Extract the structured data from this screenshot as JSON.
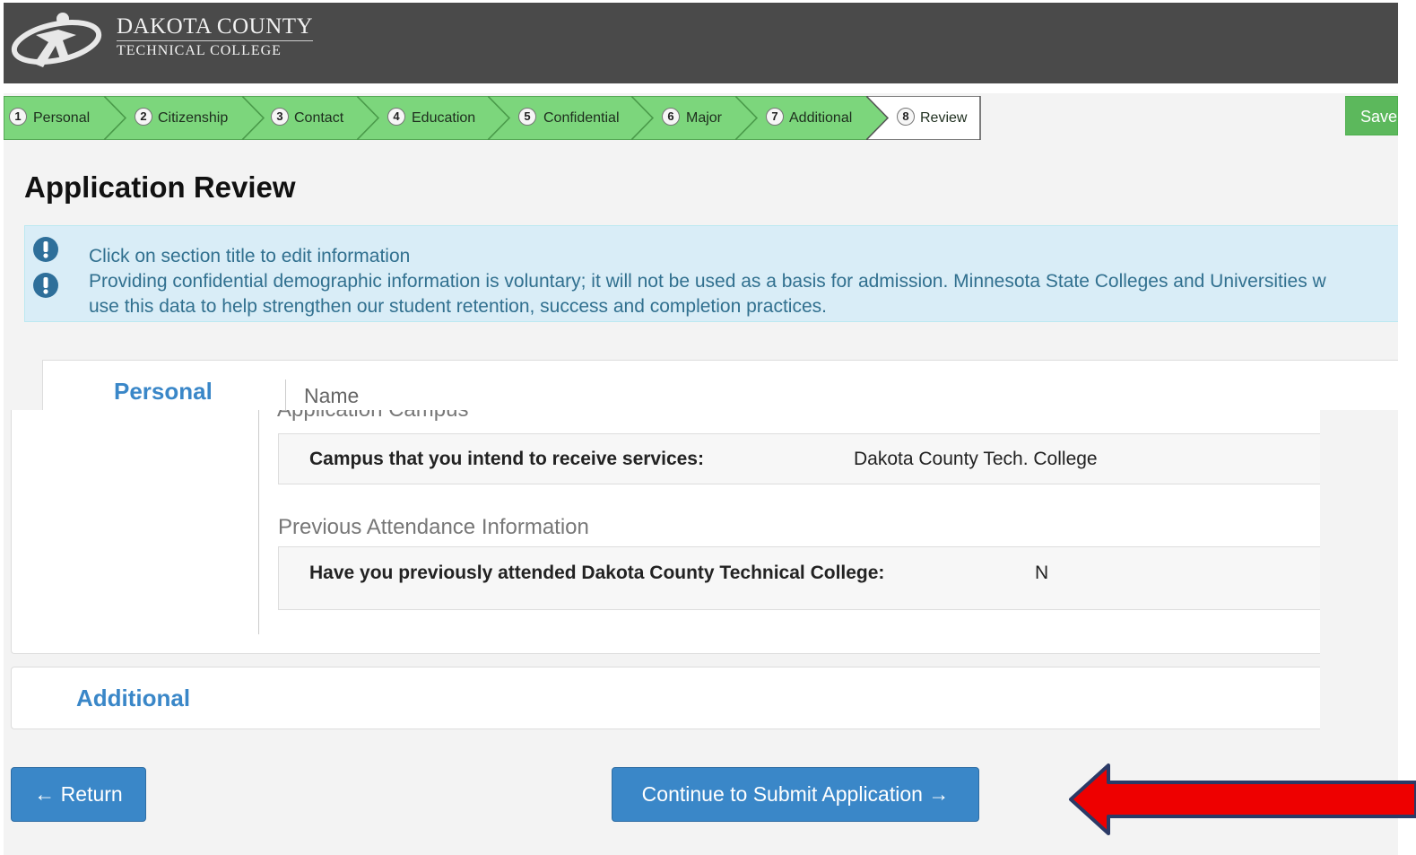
{
  "brand": {
    "line1": "DAKOTA COUNTY",
    "line2": "TECHNICAL COLLEGE"
  },
  "steps": [
    {
      "number": "1",
      "label": "Personal",
      "state": "done"
    },
    {
      "number": "2",
      "label": "Citizenship",
      "state": "done"
    },
    {
      "number": "3",
      "label": "Contact",
      "state": "done"
    },
    {
      "number": "4",
      "label": "Education",
      "state": "done"
    },
    {
      "number": "5",
      "label": "Confidential",
      "state": "done"
    },
    {
      "number": "6",
      "label": "Major",
      "state": "done"
    },
    {
      "number": "7",
      "label": "Additional",
      "state": "done"
    },
    {
      "number": "8",
      "label": "Review",
      "state": "current"
    }
  ],
  "save_label": "Save",
  "page_title": "Application Review",
  "alert": {
    "line1": "Click on section title to edit information",
    "line2": "Providing confidential demographic information is voluntary; it will not be used as a basis for admission. Minnesota State Colleges and Universities w",
    "line3": "use this data to help strengthen our student retention, success and completion practices.",
    "icon": "exclamation-circle-icon"
  },
  "personal": {
    "title": "Personal",
    "name_heading": "Name",
    "campus_heading": "Application Campus",
    "campus_question": "Campus that you intend to receive services:",
    "campus_answer": "Dakota County Tech. College",
    "attendance_heading": "Previous Attendance Information",
    "attendance_question": "Have you previously attended Dakota County Technical College:",
    "attendance_answer": "N"
  },
  "additional": {
    "title": "Additional"
  },
  "buttons": {
    "return": "← Return",
    "continue": "Continue to Submit Application →"
  },
  "colors": {
    "header_bg": "#4a4a4a",
    "step_green": "#7cd67c",
    "step_border": "#4a9a4a",
    "primary": "#3a87c8",
    "alert_bg": "#d9edf7",
    "alert_text": "#31708f",
    "arrow_red": "#ee0000"
  }
}
